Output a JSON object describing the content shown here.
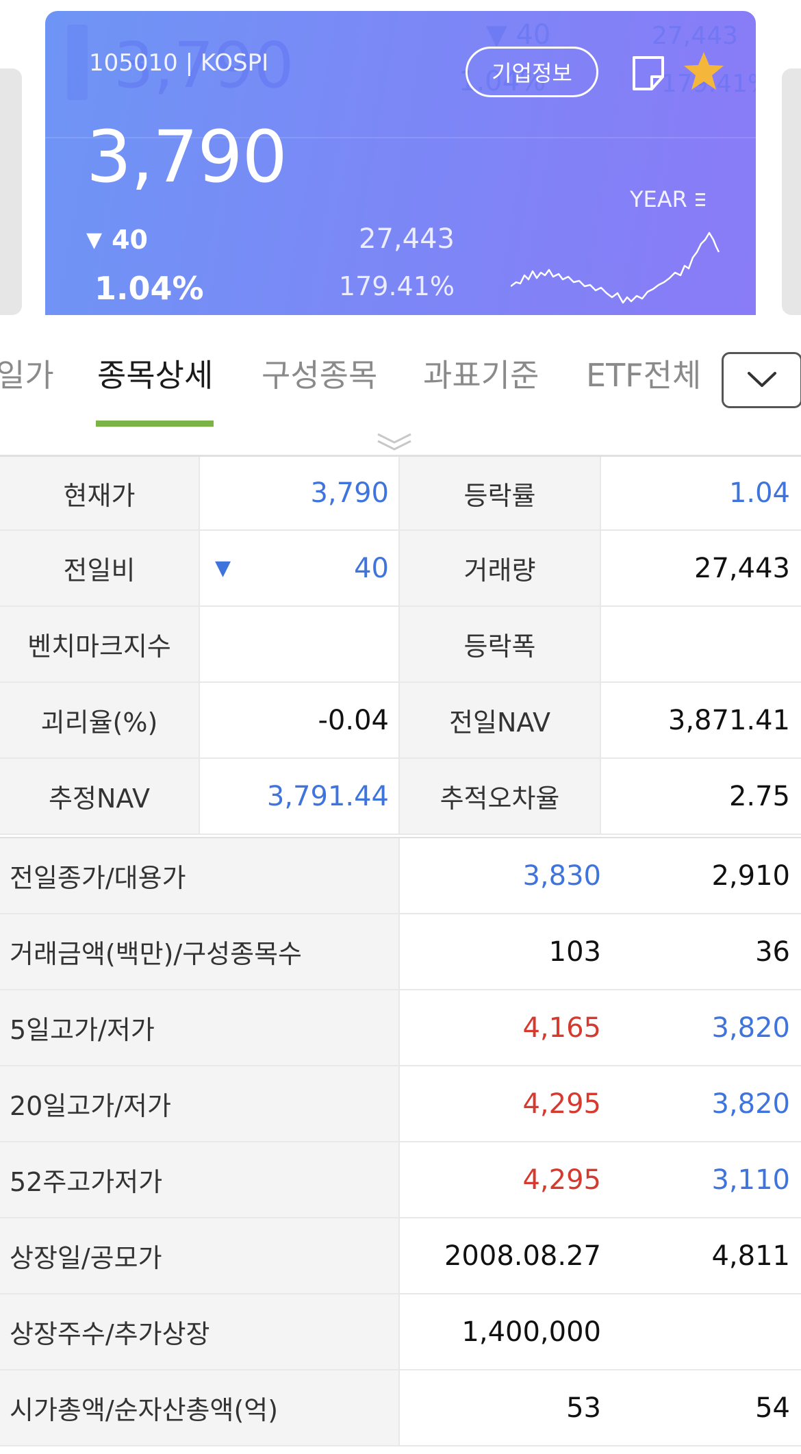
{
  "header": {
    "code_market": "105010 | KOSPI",
    "price": "3,790",
    "change_symbol": "▼",
    "change": "40",
    "change_rate": "1.04%",
    "volume": "27,443",
    "volume_rate": "179.41%",
    "company_info_label": "기업정보",
    "period_label": "YEAR",
    "accent_gradient": [
      "#6e95f5",
      "#8a7bf7"
    ]
  },
  "tabs": {
    "items": [
      "일가",
      "종목상세",
      "구성종목",
      "과표기준",
      "ETF전체"
    ],
    "active_index": 1,
    "active_color": "#7bb347"
  },
  "detail": {
    "rows": [
      {
        "l1": "현재가",
        "v1": "3,790",
        "l2": "등락률",
        "v2": "1.04"
      },
      {
        "l1": "전일비",
        "v1_symbol": "▼",
        "v1": "40",
        "l2": "거래량",
        "v2": "27,443"
      },
      {
        "l1": "벤치마크지수",
        "v1": "",
        "l2": "등락폭",
        "v2": ""
      },
      {
        "l1": "괴리율(%)",
        "v1": "-0.04",
        "l2": "전일NAV",
        "v2": "3,871.41"
      },
      {
        "l1": "추정NAV",
        "v1": "3,791.44",
        "l2": "추적오차율",
        "v2": "2.75"
      }
    ]
  },
  "list": {
    "rows": [
      {
        "label": "전일종가/대용가",
        "v1": "3,830",
        "v2": "2,910"
      },
      {
        "label": "거래금액(백만)/구성종목수",
        "v1": "103",
        "v2": "36"
      },
      {
        "label": "5일고가/저가",
        "v1": "4,165",
        "v2": "3,820"
      },
      {
        "label": "20일고가/저가",
        "v1": "4,295",
        "v2": "3,820"
      },
      {
        "label": "52주고가저가",
        "v1": "4,295",
        "v2": "3,110"
      },
      {
        "label": "상장일/공모가",
        "v1": "2008.08.27",
        "v2": "4,811"
      },
      {
        "label": "상장주수/추가상장",
        "v1": "1,400,000",
        "v2": ""
      },
      {
        "label": "시가총액/순자산총액(억)",
        "v1": "53",
        "v2": "54"
      }
    ]
  },
  "colors": {
    "up": "#d63a2f",
    "down": "#3f74dd"
  }
}
